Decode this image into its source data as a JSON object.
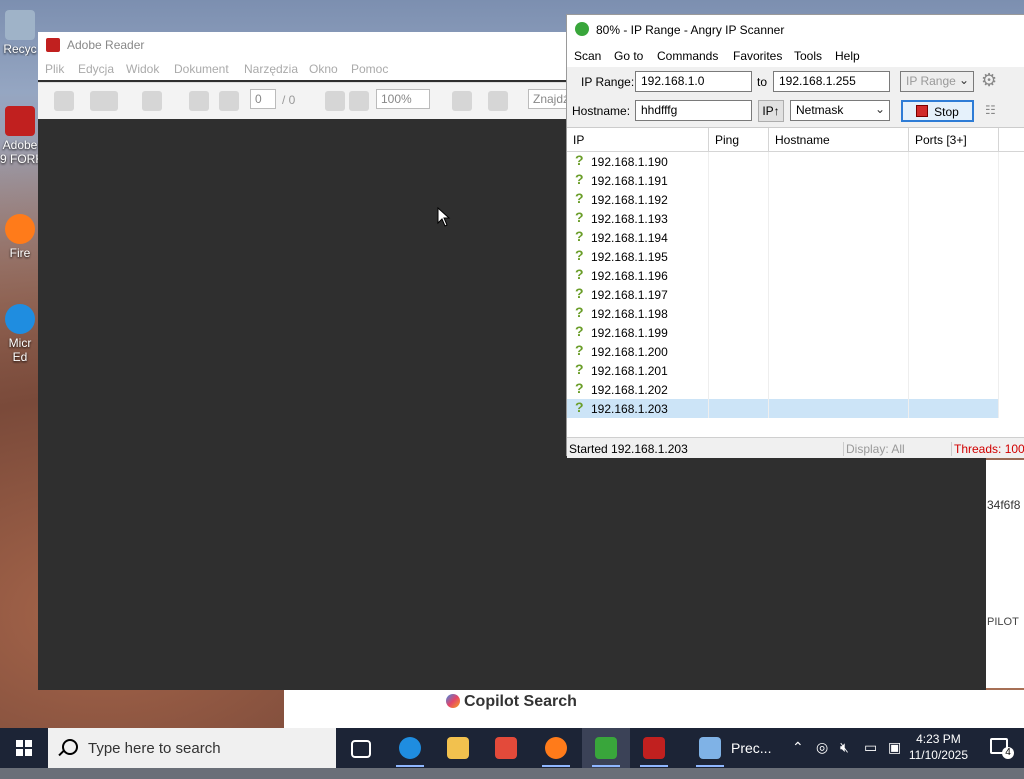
{
  "desktop": {
    "icons": [
      {
        "label": "Recyc",
        "color": "#9fb3c8"
      },
      {
        "label": "Adobe",
        "label2": "9 FORK",
        "color": "#c1201f"
      },
      {
        "label": "Fire",
        "color": "#ff7b1a"
      },
      {
        "label": "Micr",
        "label2": "Ed",
        "color": "#1f8de0"
      }
    ]
  },
  "adobe": {
    "title": "Adobe Reader",
    "menu": [
      "Plik",
      "Edycja",
      "Widok",
      "Dokument",
      "Narzędzia",
      "Okno",
      "Pomoc"
    ],
    "toolbar": {
      "page_current": "0",
      "page_total": "/ 0",
      "zoom": "100%",
      "find_placeholder": "Znajdź"
    }
  },
  "ipscanner": {
    "title": "80% - IP Range - Angry IP Scanner",
    "menu": [
      "Scan",
      "Go to",
      "Commands",
      "Favorites",
      "Tools",
      "Help"
    ],
    "form": {
      "ip_range_label": "IP Range:",
      "ip_start": "192.168.1.0",
      "to_label": "to",
      "ip_end": "192.168.1.255",
      "feeder": "IP Range",
      "hostname_label": "Hostname:",
      "hostname": "hhdfffg",
      "ip_button": "IP↑",
      "netmask": "Netmask",
      "stop_label": "Stop"
    },
    "columns": [
      "IP",
      "Ping",
      "Hostname",
      "Ports [3+]"
    ],
    "rows": [
      "192.168.1.190",
      "192.168.1.191",
      "192.168.1.192",
      "192.168.1.193",
      "192.168.1.194",
      "192.168.1.195",
      "192.168.1.196",
      "192.168.1.197",
      "192.168.1.198",
      "192.168.1.199",
      "192.168.1.200",
      "192.168.1.201",
      "192.168.1.202",
      "192.168.1.203"
    ],
    "selected_row": "192.168.1.203",
    "status": {
      "started": "Started 192.168.1.203",
      "display": "Display: All",
      "threads": "Threads: 100 ("
    }
  },
  "browser": {
    "fragment_hash": "34f6f8",
    "copilot_label": "PILOT",
    "copilot_search": "Copilot Search"
  },
  "taskbar": {
    "search_placeholder": "Type here to search",
    "weather_label": "Prec...",
    "time": "4:23 PM",
    "date": "11/10/2025",
    "notification_count": "4",
    "apps": [
      {
        "name": "task-view",
        "color": "#ffffff"
      },
      {
        "name": "edge",
        "color": "#1f8de0"
      },
      {
        "name": "file-explorer",
        "color": "#f2c14e"
      },
      {
        "name": "store",
        "color": "#e34a3a"
      },
      {
        "name": "firefox",
        "color": "#ff7b1a"
      },
      {
        "name": "angry-ip-scanner",
        "color": "#39a63b"
      },
      {
        "name": "adobe-reader",
        "color": "#c1201f"
      },
      {
        "name": "weather",
        "color": "#7fb2e6"
      }
    ]
  }
}
